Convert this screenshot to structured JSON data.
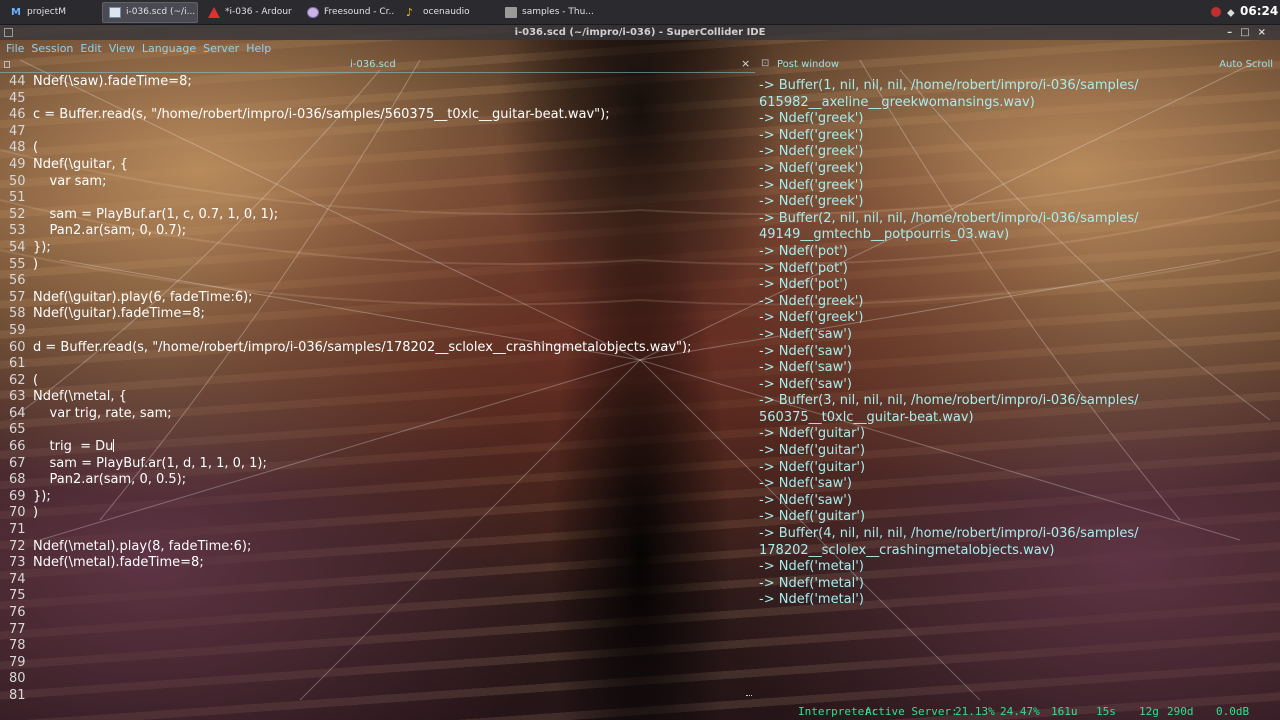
{
  "taskbar": {
    "tasks": [
      {
        "label": "projectM",
        "icon": "projectm-icon"
      },
      {
        "label": "i-036.scd (~/i...",
        "icon": "text-editor-icon"
      },
      {
        "label": "*i-036 - Ardour",
        "icon": "ardour-icon"
      },
      {
        "label": "Freesound - Cr...",
        "icon": "browser-icon"
      },
      {
        "label": "ocenaudio",
        "icon": "ocenaudio-icon"
      },
      {
        "label": "samples - Thu...",
        "icon": "folder-icon"
      }
    ],
    "clock": "06:24"
  },
  "window": {
    "title": "i-036.scd (~/impro/i-036) - SuperCollider IDE"
  },
  "menu": [
    "File",
    "Session",
    "Edit",
    "View",
    "Language",
    "Server",
    "Help"
  ],
  "editor": {
    "tab_label": "i-036.scd",
    "close_glyph": "×",
    "lines": [
      {
        "n": "44",
        "t": "Ndef(\\saw).fadeTime=8;"
      },
      {
        "n": "45",
        "t": ""
      },
      {
        "n": "46",
        "t": "c = Buffer.read(s, \"/home/robert/impro/i-036/samples/560375__t0xlc__guitar-beat.wav\");"
      },
      {
        "n": "47",
        "t": ""
      },
      {
        "n": "48",
        "t": "("
      },
      {
        "n": "49",
        "t": "Ndef(\\guitar, {"
      },
      {
        "n": "50",
        "t": "    var sam;"
      },
      {
        "n": "51",
        "t": ""
      },
      {
        "n": "52",
        "t": "    sam = PlayBuf.ar(1, c, 0.7, 1, 0, 1);"
      },
      {
        "n": "53",
        "t": "    Pan2.ar(sam, 0, 0.7);"
      },
      {
        "n": "54",
        "t": "});"
      },
      {
        "n": "55",
        "t": ")"
      },
      {
        "n": "56",
        "t": ""
      },
      {
        "n": "57",
        "t": "Ndef(\\guitar).play(6, fadeTime:6);"
      },
      {
        "n": "58",
        "t": "Ndef(\\guitar).fadeTime=8;"
      },
      {
        "n": "59",
        "t": ""
      },
      {
        "n": "60",
        "t": "d = Buffer.read(s, \"/home/robert/impro/i-036/samples/178202__sclolex__crashingmetalobjects.wav\");"
      },
      {
        "n": "61",
        "t": ""
      },
      {
        "n": "62",
        "t": "("
      },
      {
        "n": "63",
        "t": "Ndef(\\metal, {"
      },
      {
        "n": "64",
        "t": "    var trig, rate, sam;"
      },
      {
        "n": "65",
        "t": ""
      },
      {
        "n": "66",
        "t": "    trig  = Du",
        "caret": true
      },
      {
        "n": "67",
        "t": "    sam = PlayBuf.ar(1, d, 1, 1, 0, 1);"
      },
      {
        "n": "68",
        "t": "    Pan2.ar(sam, 0, 0.5);"
      },
      {
        "n": "69",
        "t": "});"
      },
      {
        "n": "70",
        "t": ")"
      },
      {
        "n": "71",
        "t": ""
      },
      {
        "n": "72",
        "t": "Ndef(\\metal).play(8, fadeTime:6);"
      },
      {
        "n": "73",
        "t": "Ndef(\\metal).fadeTime=8;"
      },
      {
        "n": "74",
        "t": ""
      },
      {
        "n": "75",
        "t": ""
      },
      {
        "n": "76",
        "t": ""
      },
      {
        "n": "77",
        "t": ""
      },
      {
        "n": "78",
        "t": ""
      },
      {
        "n": "79",
        "t": ""
      },
      {
        "n": "80",
        "t": ""
      },
      {
        "n": "81",
        "t": ""
      }
    ]
  },
  "post": {
    "title": "Post window",
    "autoscroll": "Auto Scroll",
    "lines": [
      "-> Buffer(1, nil, nil, nil, /home/robert/impro/i-036/samples/",
      "615982__axeline__greekwomansings.wav)",
      "-> Ndef('greek')",
      "-> Ndef('greek')",
      "-> Ndef('greek')",
      "-> Ndef('greek')",
      "-> Ndef('greek')",
      "-> Ndef('greek')",
      "-> Buffer(2, nil, nil, nil, /home/robert/impro/i-036/samples/",
      "49149__gmtechb__potpourris_03.wav)",
      "-> Ndef('pot')",
      "-> Ndef('pot')",
      "-> Ndef('pot')",
      "-> Ndef('greek')",
      "-> Ndef('greek')",
      "-> Ndef('saw')",
      "-> Ndef('saw')",
      "-> Ndef('saw')",
      "-> Ndef('saw')",
      "-> Buffer(3, nil, nil, nil, /home/robert/impro/i-036/samples/",
      "560375__t0xlc__guitar-beat.wav)",
      "-> Ndef('guitar')",
      "-> Ndef('guitar')",
      "-> Ndef('guitar')",
      "-> Ndef('saw')",
      "-> Ndef('saw')",
      "-> Ndef('guitar')",
      "-> Buffer(4, nil, nil, nil, /home/robert/impro/i-036/samples/",
      "178202__sclolex__crashingmetalobjects.wav)",
      "-> Ndef('metal')",
      "-> Ndef('metal')",
      "-> Ndef('metal')"
    ]
  },
  "status": {
    "interpreter": "Interpreter:",
    "server": "Active Server:",
    "avg_cpu": "21.13%",
    "peak_cpu": "24.47%",
    "ugens": "161u",
    "synths": "15s",
    "groups": "12g",
    "synthdefs": "290d",
    "volume": "0.0dB"
  },
  "colors": {
    "code_text": "#ffffff",
    "post_text": "#a8ecec",
    "status_text": "#2fe090",
    "menu_text": "#8fd0ee"
  }
}
